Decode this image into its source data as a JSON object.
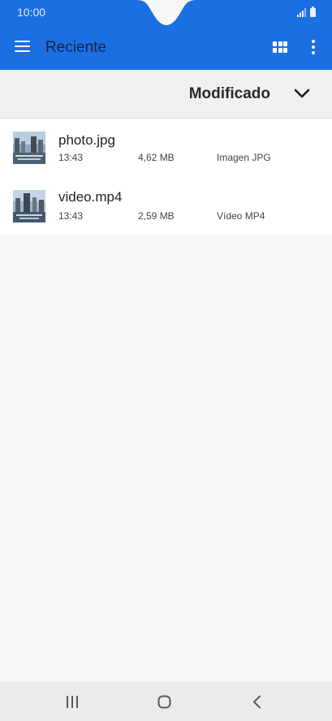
{
  "status_bar": {
    "time": "10:00",
    "icons": [
      "signal-icon",
      "battery-icon"
    ]
  },
  "app_bar": {
    "title": "Reciente",
    "icons": [
      "menu-icon",
      "grid-view-icon",
      "more-options-icon"
    ]
  },
  "sort": {
    "label": "Modificado",
    "icon": "chevron-down-icon"
  },
  "files": [
    {
      "name": "photo.jpg",
      "time": "13:43",
      "size": "4,62 MB",
      "type": "Imagen JPG",
      "thumbnail": "city-harbor-photo"
    },
    {
      "name": "video.mp4",
      "time": "13:43",
      "size": "2,59 MB",
      "type": "Vídeo MP4",
      "thumbnail": "city-harbor-video"
    }
  ],
  "nav_bar": {
    "icons": [
      "recent-apps-icon",
      "home-icon",
      "back-icon"
    ]
  },
  "colors": {
    "accent": "#1b6fe3",
    "background": "#f6f6f6",
    "list_background": "#ffffff",
    "sort_bar": "#f0f0f0",
    "nav_bar": "#ebebeb"
  }
}
